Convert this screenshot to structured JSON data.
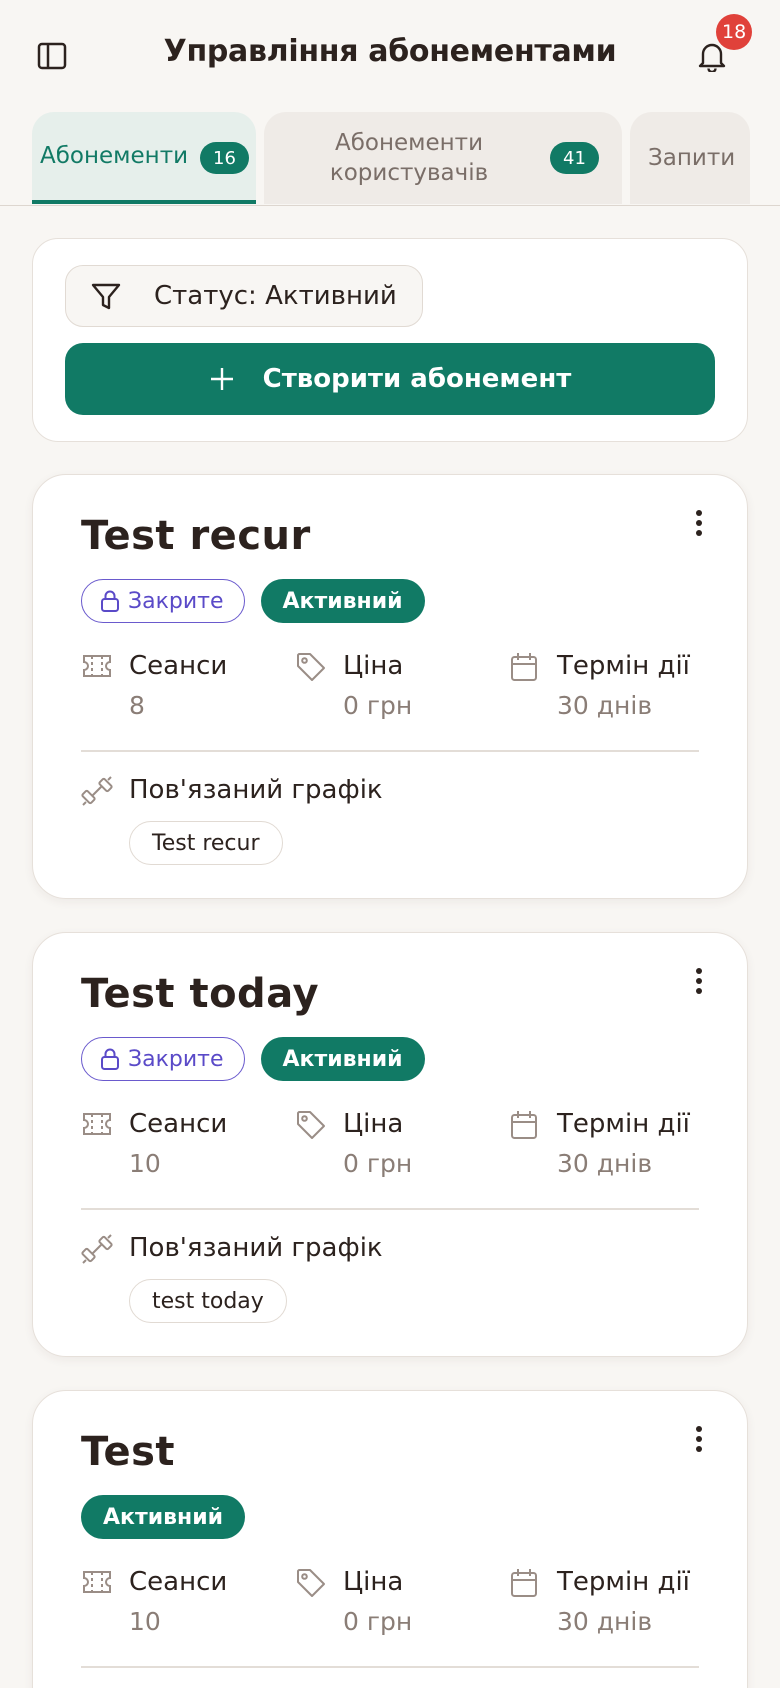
{
  "header": {
    "title": "Управління абонементами",
    "notifications_count": "18",
    "sidebar_icon": "sidebar-toggle-icon",
    "bell_icon": "bell-icon"
  },
  "tabs": [
    {
      "label": "Абонементи",
      "count": "16",
      "active": true
    },
    {
      "label": "Абонементи користувачів",
      "count": "41",
      "active": false
    },
    {
      "label": "Запити",
      "active": false
    }
  ],
  "filter": {
    "status_label": "Статус: Активний",
    "create_button": "Створити абонемент"
  },
  "labels": {
    "sessions": "Сеанси",
    "price": "Ціна",
    "term": "Термін дії",
    "schedule": "Пов'язаний графік"
  },
  "cards": [
    {
      "title": "Test recur",
      "private_badge": "Закрите",
      "status_badge": "Активний",
      "sessions": "8",
      "price": "0 грн",
      "term": "30 днів",
      "schedule": "Test recur"
    },
    {
      "title": "Test today",
      "private_badge": "Закрите",
      "status_badge": "Активний",
      "sessions": "10",
      "price": "0 грн",
      "term": "30 днів",
      "schedule": "test today"
    },
    {
      "title": "Test",
      "status_badge": "Активний",
      "sessions": "10",
      "price": "0 грн",
      "term": "30 днів"
    }
  ],
  "colors": {
    "primary": "#117a65",
    "background": "#f8f6f3",
    "badge_red": "#e0413a",
    "private_purple": "#5a4ac8"
  }
}
